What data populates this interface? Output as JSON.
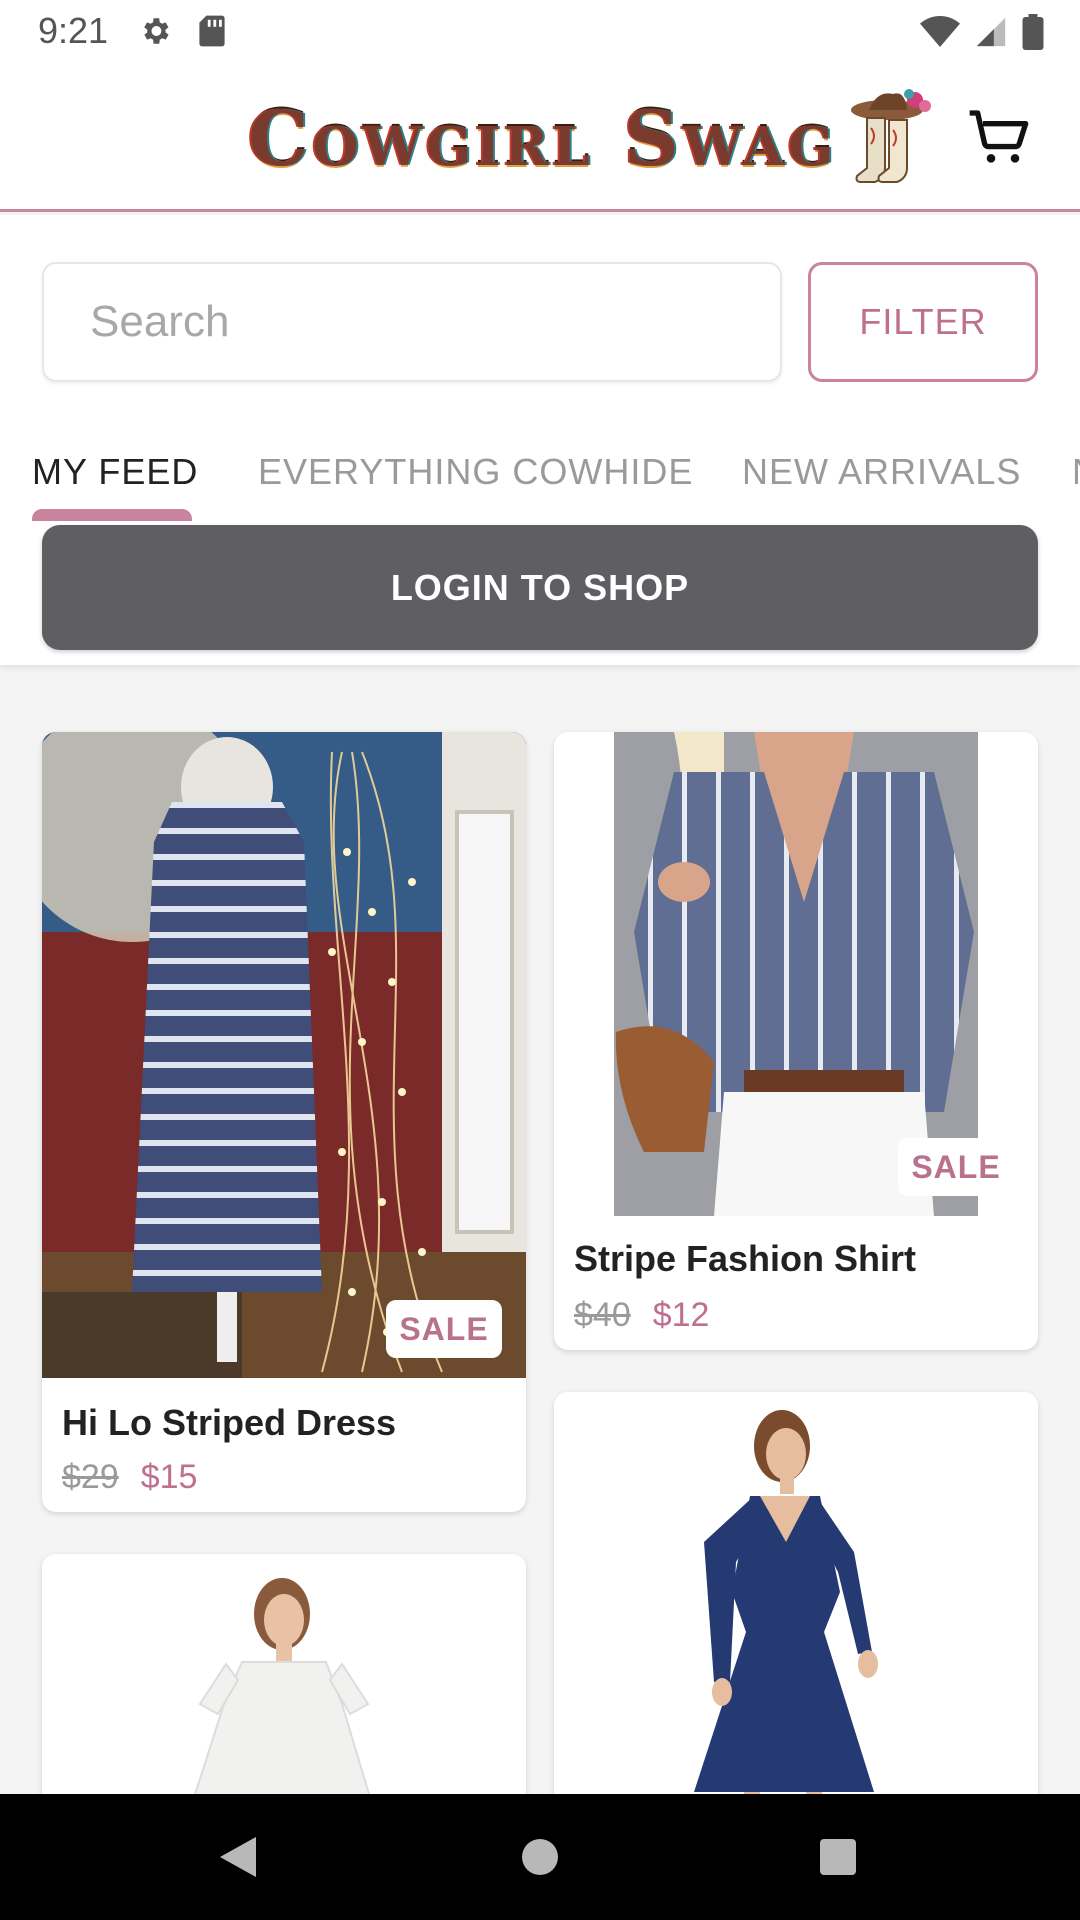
{
  "status_bar": {
    "time": "9:21",
    "icons": [
      "gear-icon",
      "sd-card-icon",
      "wifi-icon",
      "signal-icon",
      "battery-icon"
    ]
  },
  "app_bar": {
    "brand": "Cowgirl Swag",
    "cart_icon": "shopping-cart-icon"
  },
  "search": {
    "placeholder": "Search"
  },
  "filter_label": "FILTER",
  "tabs": [
    {
      "label": "MY FEED",
      "active": true
    },
    {
      "label": "EVERYTHING COWHIDE",
      "active": false
    },
    {
      "label": "NEW ARRIVALS",
      "active": false
    },
    {
      "label": "N",
      "active": false
    }
  ],
  "login_label": "LOGIN TO SHOP",
  "products": [
    {
      "name": "Hi Lo Striped Dress",
      "old_price": "$29",
      "new_price": "$15",
      "badge": "SALE"
    },
    {
      "name": "Stripe Fashion Shirt",
      "old_price": "$40",
      "new_price": "$12",
      "badge": "SALE"
    },
    {
      "name": "",
      "old_price": "",
      "new_price": "",
      "badge": ""
    },
    {
      "name": "",
      "old_price": "",
      "new_price": "",
      "badge": ""
    }
  ],
  "nav": [
    "back-icon",
    "home-icon",
    "recents-icon"
  ],
  "colors": {
    "accent": "#c0708f",
    "login_bg": "#5f5e62",
    "app_bg": "#f4f4f4",
    "divider": "#c48aa2"
  }
}
